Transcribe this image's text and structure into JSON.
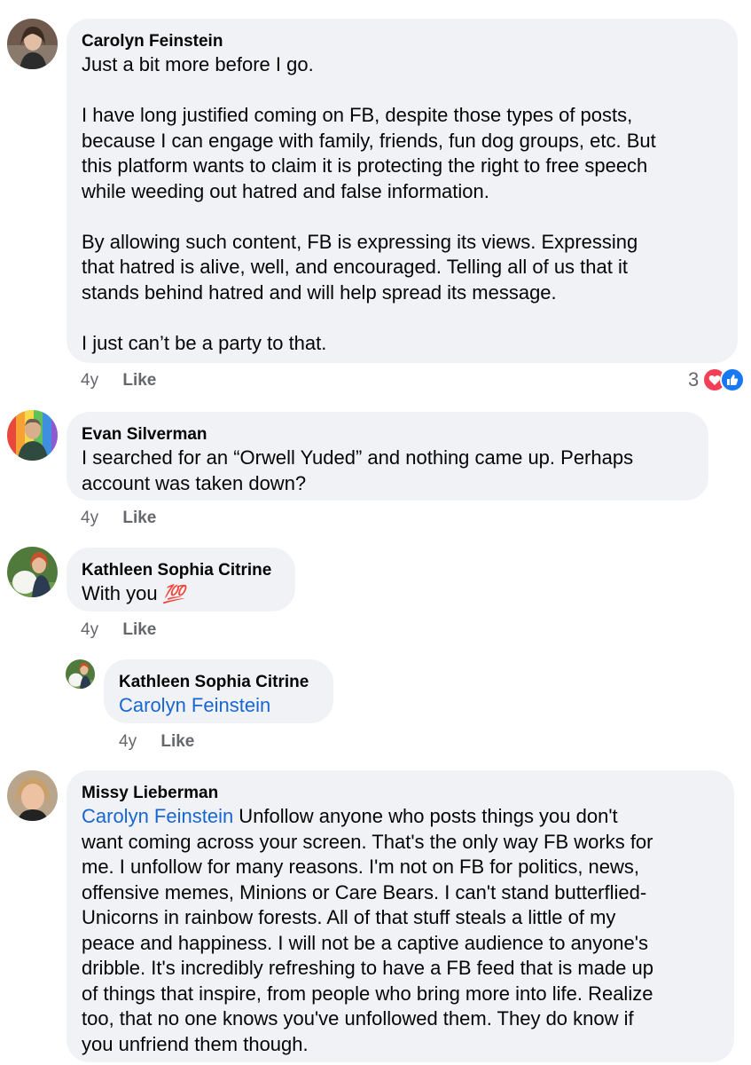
{
  "comments": [
    {
      "author": "Carolyn Feinstein",
      "text": "Just a bit more before I go.\n\nI have long justified coming on FB, despite those types of posts,\nbecause I can engage with family, friends, fun dog groups, etc. But\nthis platform wants to claim it is protecting the right to free speech\nwhile weeding out hatred and false information.\n\nBy allowing such content, FB is expressing its views. Expressing\nthat hatred is alive, well, and encouraged. Telling all of us that it\nstands behind hatred and will help spread its message.\n\nI just can’t be a party to that.",
      "time": "4y",
      "like": "Like",
      "reaction_count": "3"
    },
    {
      "author": "Evan Silverman",
      "text": "I searched for an “Orwell Yuded” and nothing came up. Perhaps\naccount was taken down?",
      "time": "4y",
      "like": "Like"
    },
    {
      "author": "Kathleen Sophia Citrine",
      "text": "With you",
      "emoji": "💯",
      "time": "4y",
      "like": "Like"
    },
    {
      "author": "Kathleen Sophia Citrine",
      "mention": "Carolyn Feinstein",
      "time": "4y",
      "like": "Like"
    },
    {
      "author": "Missy Lieberman",
      "mention": "Carolyn Feinstein",
      "text": " Unfollow anyone who posts things you don't\nwant coming across your screen. That's the only way FB works for\nme. I unfollow for many reasons. I'm not on FB for politics, news,\noffensive memes, Minions or Care Bears. I can't stand butterflied-\nUnicorns in rainbow forests. All of that stuff steals a little of my\npeace and happiness. I will not be a captive audience to anyone's\ndribble. It's incredibly refreshing to have a FB feed that is made up\nof things that inspire, from people who bring more into life. Realize\ntoo, that no one knows you've unfollowed them. They do know if\nyou unfriend them though."
    }
  ],
  "colors": {
    "bubble": "#f0f2f5",
    "mention": "#1866d2",
    "meta": "#65676b",
    "love": "#f33e58",
    "like": "#1877f2"
  },
  "icons": [
    "love-reaction-icon",
    "like-reaction-icon",
    "hundred-points-emoji"
  ]
}
